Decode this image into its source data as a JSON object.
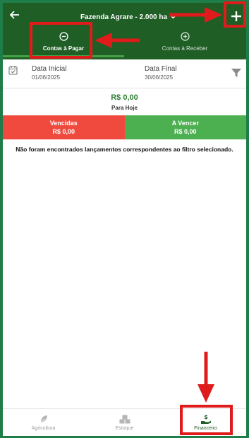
{
  "header": {
    "back_icon": "arrow-left-icon",
    "title": "Fazenda Agrare - 2.000 ha",
    "dropdown_icon": "chevron-down-icon",
    "add_icon": "plus-icon",
    "background": "#1f5e25"
  },
  "tabs": [
    {
      "label": "Contas à Pagar",
      "icon": "minus-circle-icon",
      "active": true
    },
    {
      "label": "Contas à Receber",
      "icon": "plus-circle-icon",
      "active": false
    }
  ],
  "filter": {
    "start_label": "Data Inicial",
    "start_value": "01/06/2025",
    "end_label": "Data Final",
    "end_value": "30/06/2025",
    "calendar_icon": "calendar-check-icon",
    "filter_icon": "funnel-icon"
  },
  "summary": {
    "total": "R$ 0,00",
    "total_label": "Para Hoje",
    "overdue_label": "Vencidas",
    "overdue_value": "R$ 0,00",
    "upcoming_label": "A Vencer",
    "upcoming_value": "R$ 0,00"
  },
  "empty_message": "Não foram encontrados lançamentos correspondentes ao filtro selecionado.",
  "bottom_nav": [
    {
      "label": "Agricultura",
      "icon": "leaf-icon",
      "active": false
    },
    {
      "label": "Estoque",
      "icon": "boxes-icon",
      "active": false
    },
    {
      "label": "Financeiro",
      "icon": "money-hand-icon",
      "active": true
    }
  ],
  "colors": {
    "accent_green": "#2e7d32",
    "overdue_red": "#f04a3e",
    "upcoming_green": "#4caf50",
    "annotation_red": "#e01b1b",
    "frame_green": "#1f7d49"
  }
}
